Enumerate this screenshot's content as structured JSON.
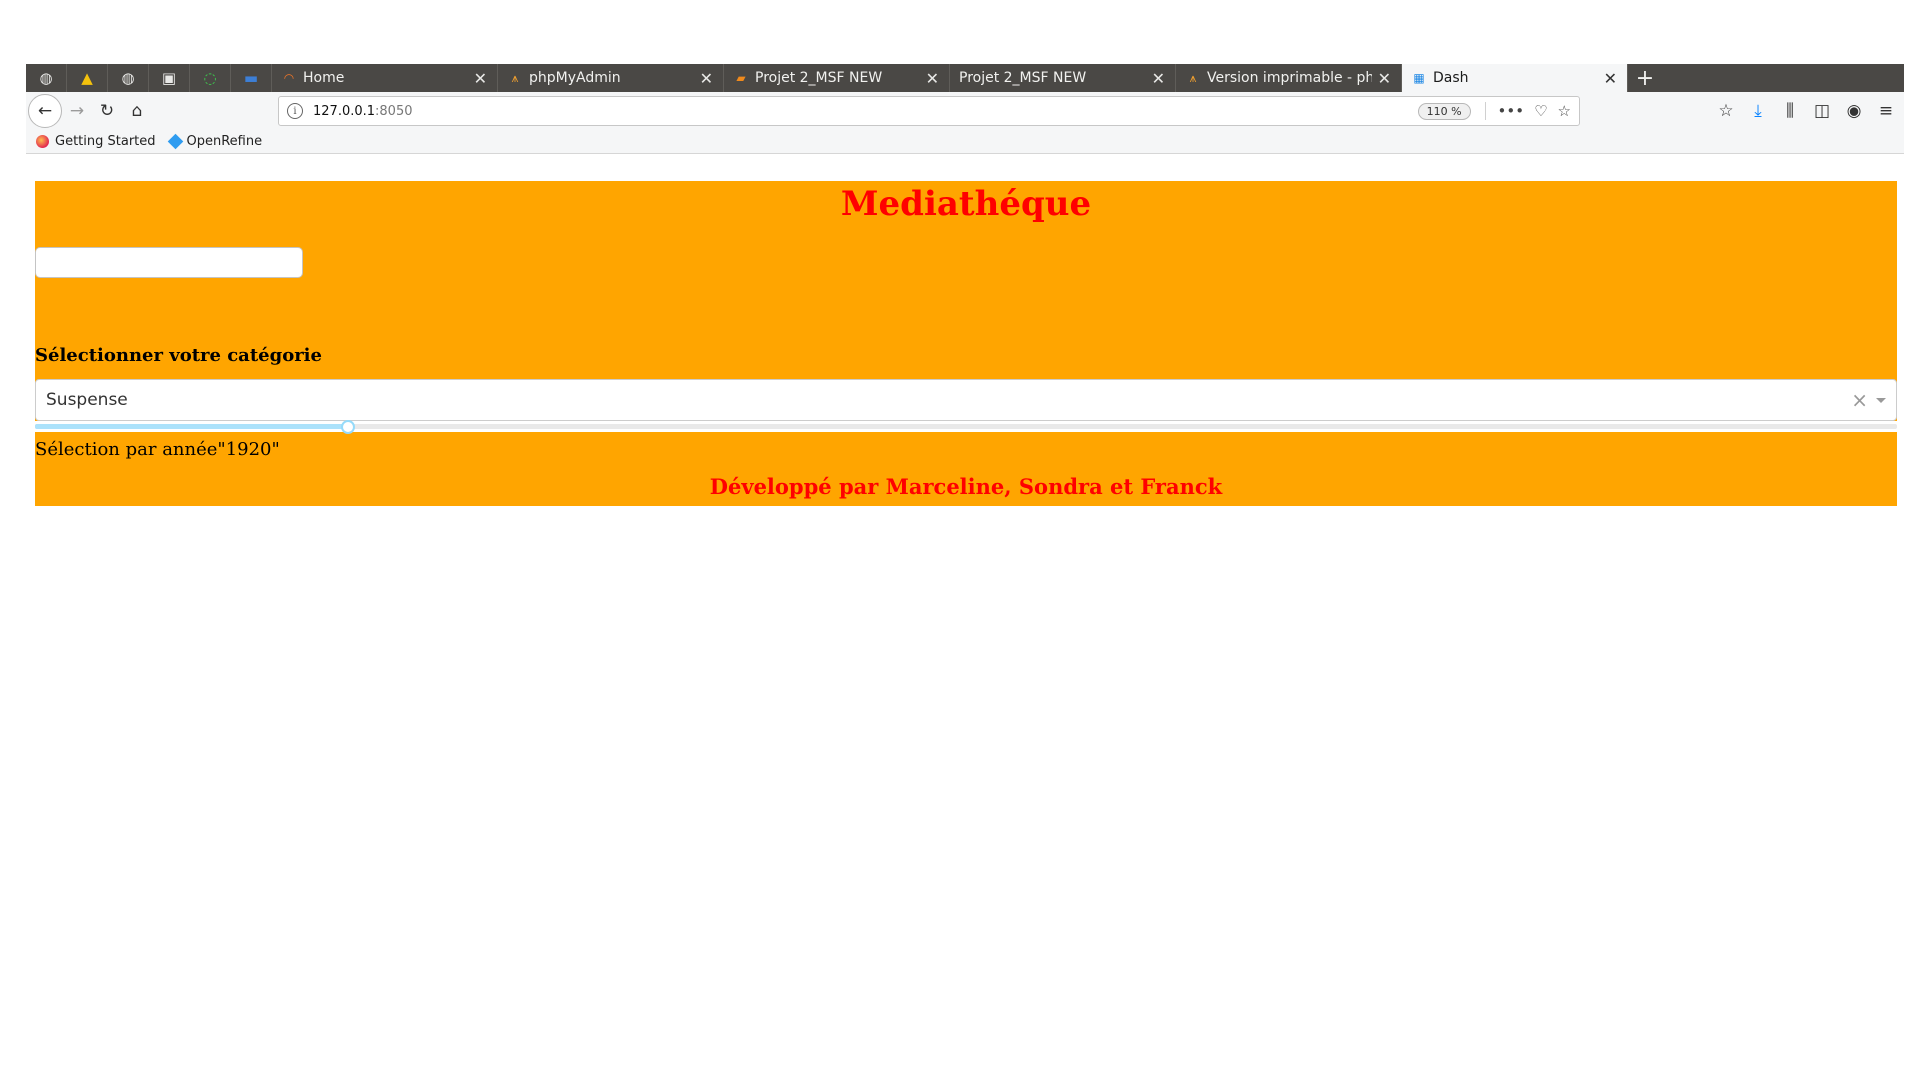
{
  "browser": {
    "pinned_tabs": [
      {
        "icon": "globe-icon",
        "glyph": "🌐"
      },
      {
        "icon": "drive-icon",
        "glyph": "▲"
      },
      {
        "icon": "globe-icon",
        "glyph": "🌐"
      },
      {
        "icon": "contact-icon",
        "glyph": "▣"
      },
      {
        "icon": "loading-icon",
        "glyph": "◌"
      },
      {
        "icon": "terminal-icon",
        "glyph": "▬"
      }
    ],
    "tabs": [
      {
        "title": "Home",
        "icon": "jupyter-icon",
        "active": false
      },
      {
        "title": "phpMyAdmin",
        "icon": "phpmyadmin-icon",
        "active": false
      },
      {
        "title": "Projet 2_MSF NEW",
        "icon": "book-icon",
        "active": false
      },
      {
        "title": "Projet 2_MSF NEW",
        "icon": "",
        "active": false
      },
      {
        "title": "Version imprimable - php",
        "icon": "phpmyadmin-icon",
        "active": false
      },
      {
        "title": "Dash",
        "icon": "dash-icon",
        "active": true
      }
    ],
    "url_host": "127.0.0.1",
    "url_port": ":8050",
    "zoom": "110 %",
    "bookmarks": [
      {
        "label": "Getting Started",
        "icon": "firefox-icon"
      },
      {
        "label": "OpenRefine",
        "icon": "openrefine-icon"
      }
    ]
  },
  "page": {
    "title": "Mediathéque",
    "text_input_value": "",
    "category_label": "Sélectionner votre catégorie",
    "dropdown_value": "Suspense",
    "slider": {
      "min": 1920,
      "max": 2020,
      "value": 1920,
      "fraction": 0.168
    },
    "year_text": "Sélection par année\"1920\"",
    "footer": "Développé par Marceline, Sondra et Franck"
  },
  "colors": {
    "page_background": "#ffa500",
    "title_color": "#ff0000",
    "slider_accent": "#96dbfa"
  }
}
